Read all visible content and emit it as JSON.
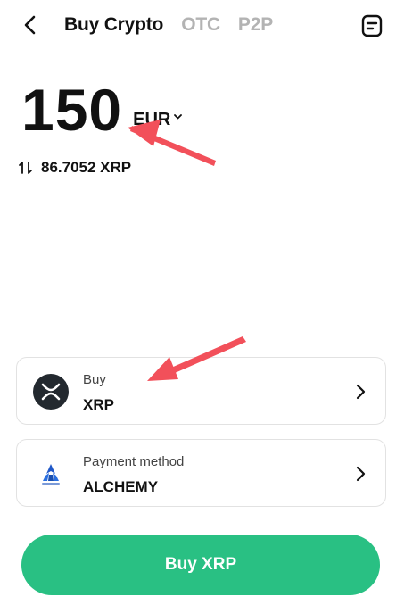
{
  "header": {
    "back_icon": "chevron-left-icon",
    "tabs": [
      {
        "label": "Buy Crypto",
        "active": true
      },
      {
        "label": "OTC",
        "active": false
      },
      {
        "label": "P2P",
        "active": false
      }
    ],
    "orders_icon": "order-history-icon"
  },
  "amount": {
    "value": "150",
    "currency": "EUR"
  },
  "conversion": {
    "icon": "swap-arrows-icon",
    "text": "86.7052 XRP"
  },
  "buy_card": {
    "label": "Buy",
    "value": "XRP",
    "icon": "xrp-logo-icon"
  },
  "payment_card": {
    "label": "Payment method",
    "value": "ALCHEMY",
    "icon": "alchemy-pay-logo-icon"
  },
  "buy_button": {
    "label": "Buy XRP"
  },
  "colors": {
    "accent_green": "#29c083",
    "annotation_red": "#f2505a",
    "inactive_tab": "#b3b3b3"
  }
}
